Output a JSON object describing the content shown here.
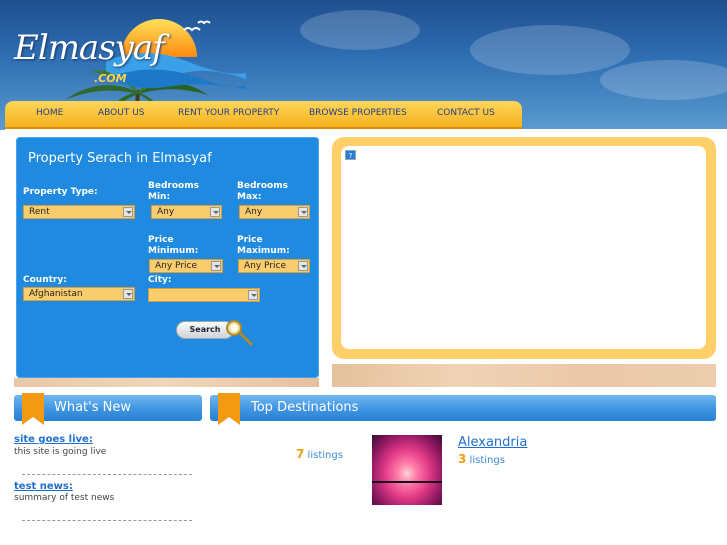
{
  "brand": {
    "logo_main": "Elmasyaf",
    "logo_suffix": ".COM"
  },
  "nav": {
    "items": [
      "HOME",
      "ABOUT US",
      "RENT YOUR PROPERTY",
      "BROWSE PROPERTIES",
      "CONTACT US"
    ]
  },
  "search": {
    "title": "Property Serach in Elmasyaf",
    "property_type_label": "Property Type:",
    "property_type_value": "Rent",
    "bed_min_label_1": "Bedrooms",
    "bed_min_label_2": "Min:",
    "bed_min_value": "Any",
    "bed_max_label_1": "Bedrooms",
    "bed_max_label_2": "Max:",
    "bed_max_value": "Any",
    "price_min_label_1": "Price",
    "price_min_label_2": "Minimum:",
    "price_min_value": "Any Price",
    "price_max_label_1": "Price",
    "price_max_label_2": "Maximum:",
    "price_max_value": "Any Price",
    "country_label": "Country:",
    "country_value": "Afghanistan",
    "city_label": "City:",
    "city_value": "",
    "button": "Search"
  },
  "banner": {
    "broken_image_glyph": "?"
  },
  "whats_new": {
    "title": "What's New",
    "items": [
      {
        "title": "site goes live:",
        "summary": "this site is going live"
      },
      {
        "title": "test news:",
        "summary": "summary of test news"
      }
    ]
  },
  "top_destinations": {
    "title": "Top Destinations",
    "first": {
      "count": "7",
      "unit": "listings"
    },
    "second": {
      "name": "Alexandria",
      "count": "3",
      "unit": "listings"
    }
  },
  "colors": {
    "accent": "#1f8ae0",
    "nav": "#f7b21f",
    "link": "#1f6fd0"
  }
}
